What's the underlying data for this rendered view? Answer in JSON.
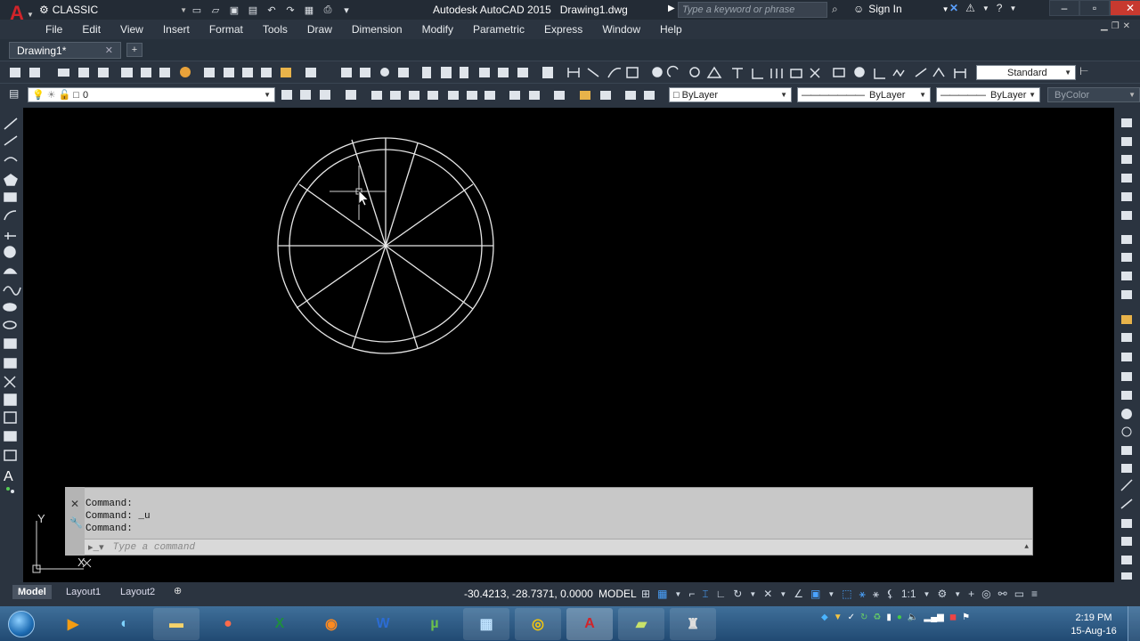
{
  "title": {
    "workspace": "CLASSIC",
    "app": "Autodesk AutoCAD 2015",
    "doc": "Drawing1.dwg"
  },
  "search": {
    "placeholder": "Type a keyword or phrase"
  },
  "signin": "Sign In",
  "menu": [
    "File",
    "Edit",
    "View",
    "Insert",
    "Format",
    "Tools",
    "Draw",
    "Dimension",
    "Modify",
    "Parametric",
    "Express",
    "Window",
    "Help"
  ],
  "tabs": {
    "doc": "Drawing1*",
    "new": "+"
  },
  "toolbar": {
    "text_style": "Standard",
    "layer": "0",
    "color": "ByLayer",
    "linetype": "ByLayer",
    "lineweight": "ByLayer",
    "plotstyle": "ByColor"
  },
  "command": {
    "history": [
      "Command:",
      "Command: _u",
      "Command:"
    ],
    "placeholder": "Type a command"
  },
  "status": {
    "layouts": [
      "Model",
      "Layout1",
      "Layout2"
    ],
    "coords": "-30.4213, -28.7371, 0.0000",
    "mode": "MODEL",
    "scale": "1:1"
  },
  "ucs": {
    "x": "X",
    "y": "Y"
  },
  "clock": {
    "time": "2:19 PM",
    "date": "15-Aug-16"
  },
  "taskbar": [
    "chrome-ish",
    "explorer",
    "camera",
    "excel",
    "firefox",
    "word",
    "utorrent",
    "control-panel",
    "chrome",
    "autocad",
    "notes",
    "recorder"
  ]
}
